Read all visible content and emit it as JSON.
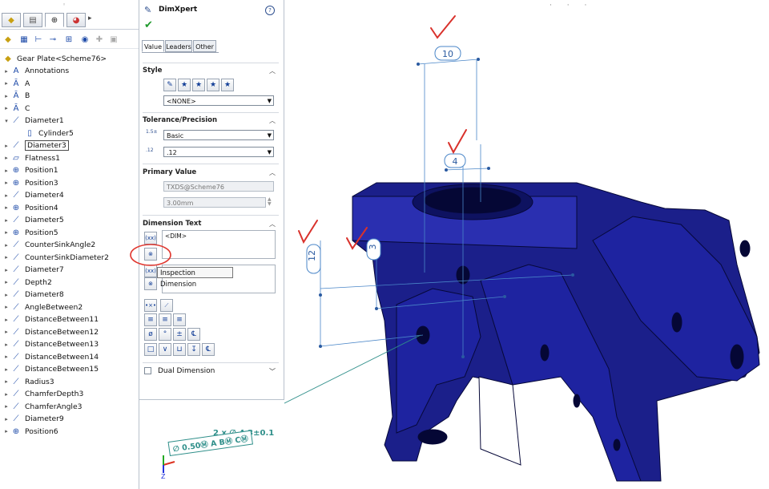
{
  "tree": {
    "root_label": "Gear Plate<Scheme76>",
    "tabs": [
      {
        "icon": "feature-manager-icon"
      },
      {
        "icon": "property-manager-icon"
      },
      {
        "icon": "configuration-manager-icon"
      },
      {
        "icon": "dimxpert-manager-icon"
      }
    ],
    "items": [
      {
        "label": "Annotations",
        "icon": "annotations-icon",
        "expander": "collapsed"
      },
      {
        "label": "A",
        "icon": "datum-icon",
        "expander": "collapsed"
      },
      {
        "label": "B",
        "icon": "datum-icon",
        "expander": "collapsed"
      },
      {
        "label": "C",
        "icon": "datum-icon",
        "expander": "collapsed"
      },
      {
        "label": "Diameter1",
        "icon": "diameter-icon",
        "expander": "expanded"
      },
      {
        "label": "Cylinder5",
        "icon": "cylinder-icon",
        "expander": "none"
      },
      {
        "label": "Diameter3",
        "icon": "diameter-icon",
        "expander": "collapsed",
        "selected": true
      },
      {
        "label": "Flatness1",
        "icon": "flatness-icon",
        "expander": "collapsed"
      },
      {
        "label": "Position1",
        "icon": "position-icon",
        "expander": "collapsed"
      },
      {
        "label": "Position3",
        "icon": "position-icon",
        "expander": "collapsed"
      },
      {
        "label": "Diameter4",
        "icon": "diameter-icon",
        "expander": "collapsed"
      },
      {
        "label": "Position4",
        "icon": "position-icon",
        "expander": "collapsed"
      },
      {
        "label": "Diameter5",
        "icon": "diameter-icon",
        "expander": "collapsed"
      },
      {
        "label": "Position5",
        "icon": "position-icon",
        "expander": "collapsed"
      },
      {
        "label": "CounterSinkAngle2",
        "icon": "diameter-icon",
        "expander": "collapsed"
      },
      {
        "label": "CounterSinkDiameter2",
        "icon": "diameter-icon",
        "expander": "collapsed"
      },
      {
        "label": "Diameter7",
        "icon": "diameter-icon",
        "expander": "collapsed"
      },
      {
        "label": "Depth2",
        "icon": "diameter-icon",
        "expander": "collapsed"
      },
      {
        "label": "Diameter8",
        "icon": "diameter-icon",
        "expander": "collapsed"
      },
      {
        "label": "AngleBetween2",
        "icon": "diameter-icon",
        "expander": "collapsed"
      },
      {
        "label": "DistanceBetween11",
        "icon": "diameter-icon",
        "expander": "collapsed"
      },
      {
        "label": "DistanceBetween12",
        "icon": "diameter-icon",
        "expander": "collapsed"
      },
      {
        "label": "DistanceBetween13",
        "icon": "diameter-icon",
        "expander": "collapsed"
      },
      {
        "label": "DistanceBetween14",
        "icon": "diameter-icon",
        "expander": "collapsed"
      },
      {
        "label": "DistanceBetween15",
        "icon": "diameter-icon",
        "expander": "collapsed"
      },
      {
        "label": "Radius3",
        "icon": "diameter-icon",
        "expander": "collapsed"
      },
      {
        "label": "ChamferDepth3",
        "icon": "diameter-icon",
        "expander": "collapsed"
      },
      {
        "label": "ChamferAngle3",
        "icon": "diameter-icon",
        "expander": "collapsed"
      },
      {
        "label": "Diameter9",
        "icon": "diameter-icon",
        "expander": "collapsed"
      },
      {
        "label": "Position6",
        "icon": "position-icon",
        "expander": "collapsed"
      }
    ]
  },
  "pm": {
    "title": "DimXpert",
    "help": "?",
    "tabs": [
      "Value",
      "Leaders",
      "Other"
    ],
    "style": {
      "title": "Style",
      "combo": "<NONE>"
    },
    "tolerance": {
      "title": "Tolerance/Precision",
      "type": "Basic",
      "precision": ".12"
    },
    "primary_value": {
      "title": "Primary Value",
      "name": "TXDS@Scheme76",
      "value": "3.00mm"
    },
    "dimension_text": {
      "title": "Dimension Text",
      "text": "<DIM>"
    },
    "dual_dimension": {
      "title": "Dual Dimension"
    },
    "tooltip": "Inspection Dimension"
  },
  "viewport": {
    "balloons": [
      "10",
      "4",
      "12",
      "3"
    ],
    "callout_line1": "2 x ∅ 4.3±0.1",
    "callout_line2": "∅ 0.50Ⓜ A BⓂ CⓂ",
    "triad_axis": "Z"
  },
  "colors": {
    "part": "#1b1f8a",
    "annotation": "#2f8f8a",
    "check": "#d9312b",
    "circle": "#e0372f"
  }
}
